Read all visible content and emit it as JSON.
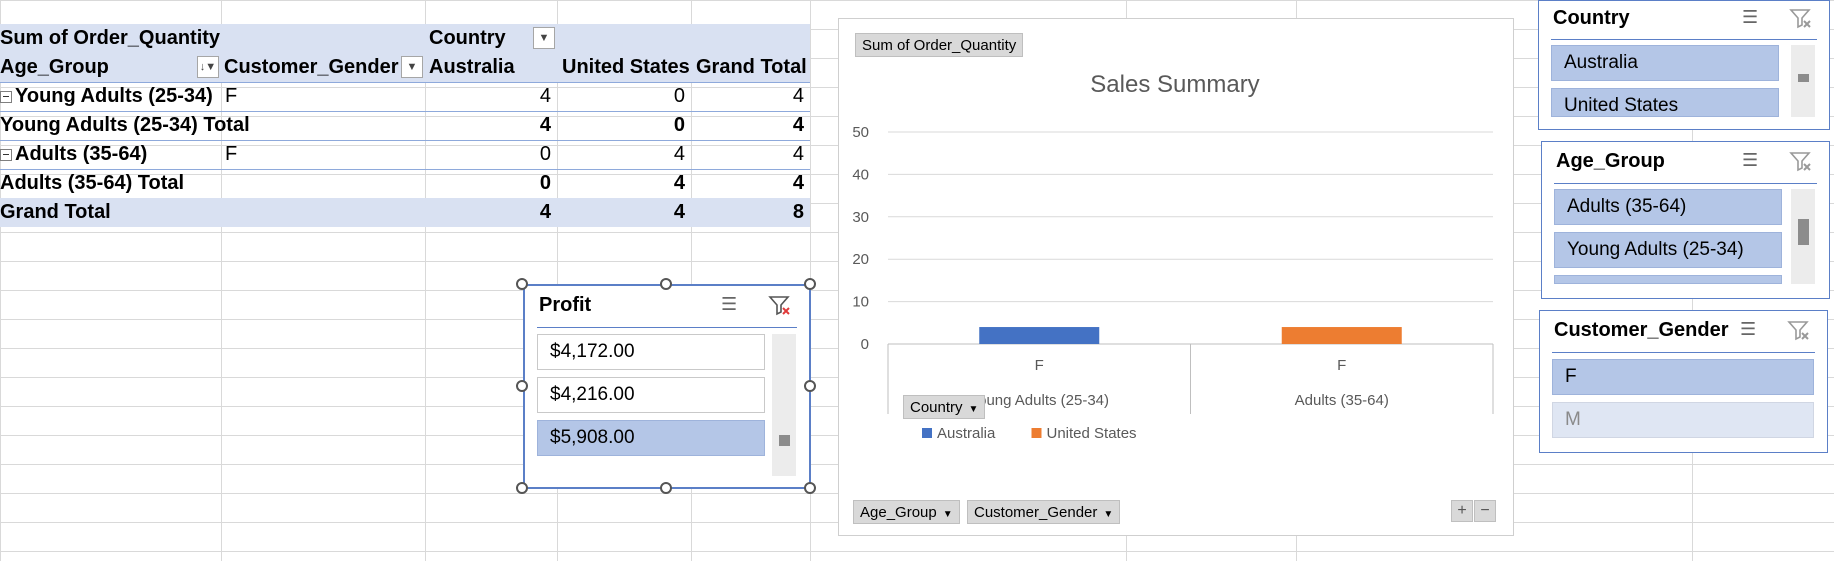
{
  "pivot": {
    "header1": {
      "value_field": "Sum of Order_Quantity",
      "column_field": "Country"
    },
    "header2": {
      "row_field1": "Age_Group",
      "row_field2": "Customer_Gender",
      "col1": "Australia",
      "col2": "United States",
      "col3": "Grand Total"
    },
    "rows": [
      {
        "label": "Young Adults (25-34)",
        "gender": "F",
        "australia": "4",
        "us": "0",
        "total": "4"
      },
      {
        "label": "Young Adults (25-34) Total",
        "australia": "4",
        "us": "0",
        "total": "4"
      },
      {
        "label": "Adults (35-64)",
        "gender": "F",
        "australia": "0",
        "us": "4",
        "total": "4"
      },
      {
        "label": "Adults (35-64) Total",
        "australia": "0",
        "us": "4",
        "total": "4"
      },
      {
        "label": "Grand Total",
        "australia": "4",
        "us": "4",
        "total": "8"
      }
    ]
  },
  "slicers": {
    "profit": {
      "title": "Profit",
      "items": [
        "$4,172.00",
        "$4,216.00",
        "$5,908.00"
      ]
    },
    "country": {
      "title": "Country",
      "items": [
        "Australia",
        "United States"
      ]
    },
    "age_group": {
      "title": "Age_Group",
      "items": [
        "Adults (35-64)",
        "Young Adults (25-34)"
      ]
    },
    "gender": {
      "title": "Customer_Gender",
      "items": [
        "F",
        "M"
      ]
    }
  },
  "chart": {
    "value_button": "Sum of Order_Quantity",
    "legend_button": "Country",
    "axis_buttons": [
      "Age_Group",
      "Customer_Gender"
    ],
    "colors": {
      "Australia": "#4472c4",
      "United States": "#ed7d31"
    }
  },
  "chart_data": {
    "type": "bar",
    "title": "Sales Summary",
    "categories": [
      {
        "outer": "Young Adults (25-34)",
        "inner": "F"
      },
      {
        "outer": "Adults (35-64)",
        "inner": "F"
      }
    ],
    "series": [
      {
        "name": "Australia",
        "values": [
          4,
          0
        ]
      },
      {
        "name": "United States",
        "values": [
          0,
          4
        ]
      }
    ],
    "yticks": [
      "0",
      "10",
      "20",
      "30",
      "40",
      "50"
    ],
    "ylim": [
      0,
      50
    ],
    "grid": true,
    "legend": "bottom"
  }
}
